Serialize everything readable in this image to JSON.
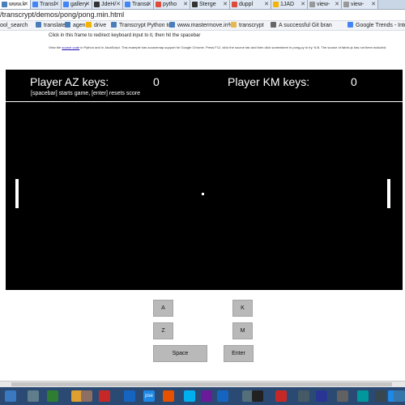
{
  "browser": {
    "tabs": [
      {
        "title": "www.k",
        "active": true,
        "color": "#4a7ebb"
      },
      {
        "title": "Transl",
        "color": "#4285f4"
      },
      {
        "title": "gallery",
        "color": "#4285f4"
      },
      {
        "title": "JdeH/",
        "color": "#333333"
      },
      {
        "title": "Transc",
        "color": "#4285f4"
      },
      {
        "title": "pytho",
        "color": "#dd4b39"
      },
      {
        "title": "Sterge",
        "color": "#333333"
      },
      {
        "title": "duppl",
        "color": "#dd4b39"
      },
      {
        "title": "1JAD",
        "color": "#f4b400"
      },
      {
        "title": "view-",
        "color": "#999999"
      },
      {
        "title": "view-",
        "color": "#999999"
      }
    ],
    "url": "/transcrypt/demos/pong/pong.min.html",
    "bookmarks": [
      {
        "label": "ool_search",
        "color": "#999999"
      },
      {
        "label": "translate",
        "color": "#4a7ebb"
      },
      {
        "label": "agenda",
        "color": "#4a7ebb"
      },
      {
        "label": "drive",
        "color": "#f4b400"
      },
      {
        "label": "Transcrypt Python to",
        "color": "#4a7ebb"
      },
      {
        "label": "www.mastermove.in%",
        "color": "#4a7ebb"
      },
      {
        "label": "transcrypt",
        "color": "#e8b84a"
      },
      {
        "label": "A successful Git bran",
        "color": "#666666"
      },
      {
        "label": "Google Trends - Inte",
        "color": "#4285f4"
      }
    ]
  },
  "page": {
    "instruction": "Click in this frame to redirect keyboard input to it, then hit the spacebar",
    "source_prefix": "View the ",
    "source_link": "source code",
    "source_suffix": " in Python and in JavaScript. This example has sourcemap support for Google Chrome. Press F12, click the source tab and then click somewhere in pong.py to try. N.B. The source of fabric.js has not been included."
  },
  "game": {
    "player_az_label": "Player AZ keys:",
    "player_az_score": "0",
    "player_km_label": "Player KM keys:",
    "player_km_score": "0",
    "hint": "[spacebar] starts game, [enter] resets score",
    "background": "#000000",
    "foreground": "#ffffff"
  },
  "controls": {
    "a": "A",
    "k": "K",
    "z": "Z",
    "m": "M",
    "space": "Space",
    "enter": "Enter"
  },
  "taskbar": {
    "icons": [
      {
        "name": "start-icon",
        "color": "#3a78c2",
        "label": ""
      },
      {
        "name": "printer-icon",
        "color": "#607d8b",
        "label": ""
      },
      {
        "name": "chart-icon",
        "color": "#2e7d32",
        "label": ""
      },
      {
        "name": "folder-icon",
        "color": "#e0a030",
        "label": ""
      },
      {
        "name": "search-icon",
        "color": "#8d6e63",
        "label": ""
      },
      {
        "name": "chrome-icon",
        "color": "#c62828",
        "label": ""
      },
      {
        "name": "globe-icon",
        "color": "#1565c0",
        "label": ""
      },
      {
        "name": "pse-icon",
        "color": "#1e88e5",
        "label": "pse"
      },
      {
        "name": "firefox-icon",
        "color": "#e65100",
        "label": ""
      },
      {
        "name": "skype-icon",
        "color": "#00aff0",
        "label": ""
      },
      {
        "name": "media-icon",
        "color": "#6a1b9a",
        "label": ""
      },
      {
        "name": "word-icon",
        "color": "#1565c0",
        "label": ""
      },
      {
        "name": "tools-icon",
        "color": "#546e7a",
        "label": ""
      },
      {
        "name": "terminal-icon",
        "color": "#212121",
        "label": ""
      },
      {
        "name": "paint-icon",
        "color": "#c62828",
        "label": ""
      },
      {
        "name": "settings-icon",
        "color": "#455a64",
        "label": ""
      },
      {
        "name": "app-icon",
        "color": "#283593",
        "label": ""
      },
      {
        "name": "gear-icon",
        "color": "#616161",
        "label": ""
      },
      {
        "name": "arduino-icon",
        "color": "#00979d",
        "label": ""
      },
      {
        "name": "network-icon",
        "color": "#37474f",
        "label": ""
      },
      {
        "name": "code-icon",
        "color": "#1e88e5",
        "label": ""
      },
      {
        "name": "python-icon",
        "color": "#3776ab",
        "label": ""
      }
    ]
  }
}
